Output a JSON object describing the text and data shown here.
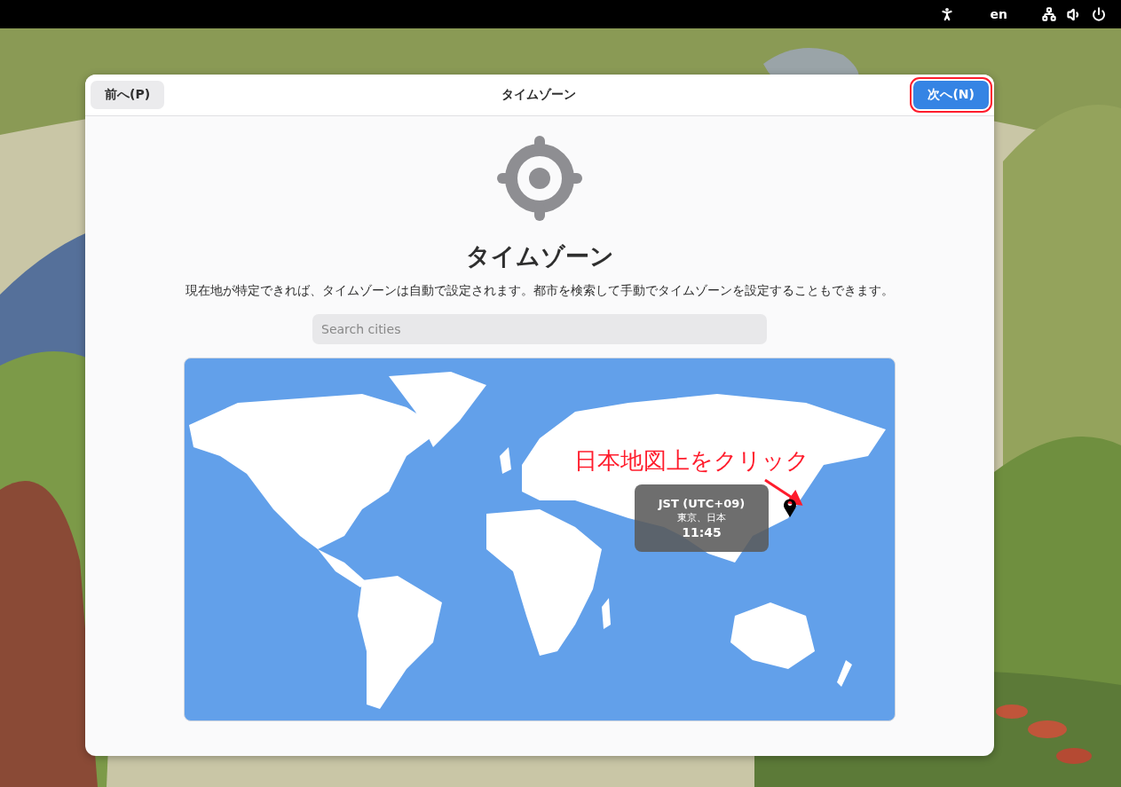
{
  "top_bar": {
    "language": "en"
  },
  "dialog": {
    "back_button": "前へ(P)",
    "title": "タイムゾーン",
    "next_button": {
      "label": "次へ(N)",
      "annotated": true
    },
    "heading": "タイムゾーン",
    "description": "現在地が特定できれば、タイムゾーンは自動で設定されます。都市を検索して手動でタイムゾーンを設定することもできます。",
    "search": {
      "placeholder": "Search cities"
    },
    "map": {
      "annotation": "日本地図上をクリック",
      "tooltip": {
        "zone": "JST (UTC+09)",
        "place": "東京、日本",
        "time": "11:45"
      }
    }
  }
}
